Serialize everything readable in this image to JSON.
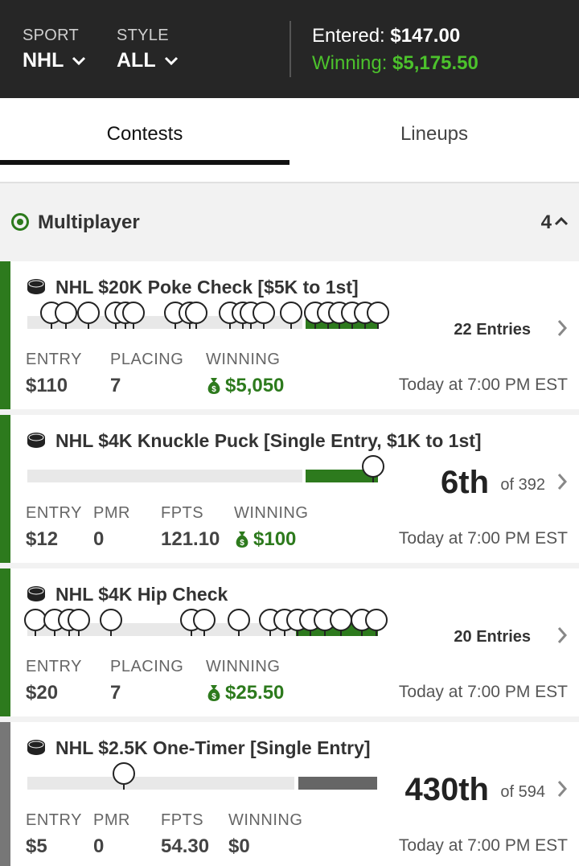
{
  "header": {
    "sport_label": "SPORT",
    "sport_value": "NHL",
    "style_label": "STYLE",
    "style_value": "ALL",
    "entered_label": "Entered:",
    "entered_value": "$147.00",
    "winning_label": "Winning:",
    "winning_value": "$5,175.50",
    "colors": {
      "background": "#262626",
      "winning_green": "#4cc22c"
    }
  },
  "tabs": [
    {
      "label": "Contests",
      "active": true
    },
    {
      "label": "Lineups",
      "active": false
    }
  ],
  "section": {
    "title": "Multiplayer",
    "count": "4",
    "icon": "radio-selected-icon",
    "collapse_icon": "chevron-up-icon"
  },
  "contests": [
    {
      "title": "NHL $20K Poke Check [$5K to 1st]",
      "entries_text": "22 Entries",
      "fields": [
        {
          "label": "ENTRY",
          "value": "$110"
        },
        {
          "label": "PLACING",
          "value": "7"
        },
        {
          "label": "WINNING",
          "value": "$5,050",
          "money_icon": true
        }
      ],
      "time": "Today at 7:00 PM EST",
      "status_color": "#2d7a1d"
    },
    {
      "title": "NHL $4K Knuckle Puck [Single Entry, $1K to 1st]",
      "rank": "6th",
      "rank_of": "of 392",
      "fields": [
        {
          "label": "ENTRY",
          "value": "$12"
        },
        {
          "label": "PMR",
          "value": "0"
        },
        {
          "label": "FPTS",
          "value": "121.10"
        },
        {
          "label": "WINNING",
          "value": "$100",
          "money_icon": true
        }
      ],
      "time": "Today at 7:00 PM EST",
      "status_color": "#2d7a1d"
    },
    {
      "title": "NHL $4K Hip Check",
      "entries_text": "20 Entries",
      "fields": [
        {
          "label": "ENTRY",
          "value": "$20"
        },
        {
          "label": "PLACING",
          "value": "7"
        },
        {
          "label": "WINNING",
          "value": "$25.50",
          "money_icon": true
        }
      ],
      "time": "Today at 7:00 PM EST",
      "status_color": "#2d7a1d"
    },
    {
      "title": "NHL $2.5K One-Timer [Single Entry]",
      "rank": "430th",
      "rank_of": "of 594",
      "fields": [
        {
          "label": "ENTRY",
          "value": "$5"
        },
        {
          "label": "PMR",
          "value": "0"
        },
        {
          "label": "FPTS",
          "value": "54.30"
        },
        {
          "label": "WINNING",
          "value": "$0"
        }
      ],
      "time": "Today at 7:00 PM EST",
      "status_color": "#777777"
    }
  ]
}
